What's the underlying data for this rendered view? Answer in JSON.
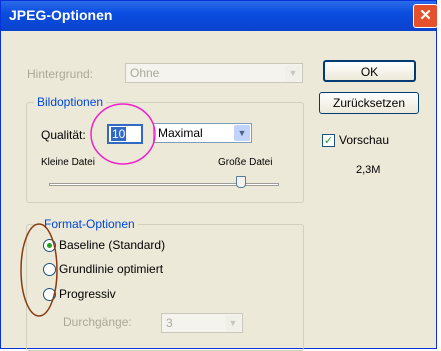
{
  "window": {
    "title": "JPEG-Optionen",
    "close_symbol": "✕"
  },
  "background": {
    "label": "Hintergrund:",
    "value": "Ohne"
  },
  "buttons": {
    "ok": "OK",
    "reset": "Zurücksetzen"
  },
  "preview": {
    "label": "Vorschau",
    "checked": true,
    "size": "2,3M"
  },
  "image_options": {
    "legend": "Bildoptionen",
    "quality_label": "Qualität:",
    "quality_value": "10",
    "quality_preset": "Maximal",
    "small_file": "Kleine Datei",
    "large_file": "Große Datei",
    "slider_level": 10,
    "slider_max": 12
  },
  "format_options": {
    "legend": "Format-Optionen",
    "options": [
      "Baseline (Standard)",
      "Grundlinie optimiert",
      "Progressiv"
    ],
    "selected_index": 0,
    "passes_label": "Durchgänge:",
    "passes_value": "3"
  },
  "annotations": {
    "circle_color": "#ee22cc",
    "oval_color": "#8b3a0f"
  }
}
